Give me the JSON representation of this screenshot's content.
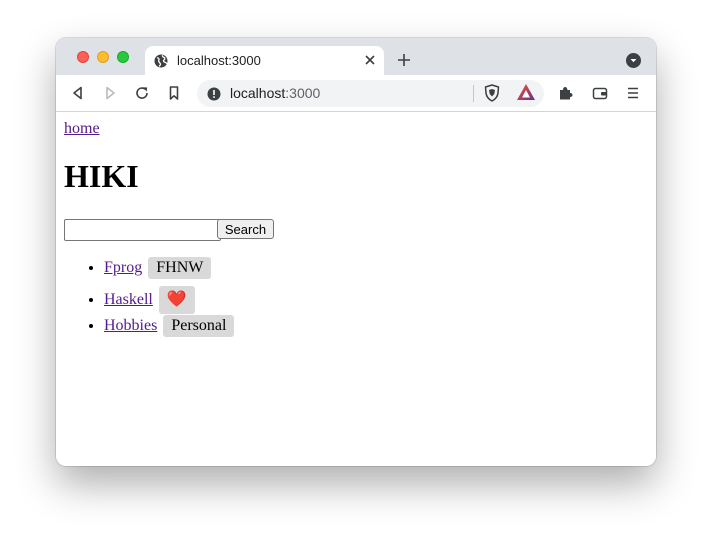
{
  "browser": {
    "tab_title": "localhost:3000",
    "url_host": "localhost",
    "url_port": ":3000",
    "icons": {
      "tab_favicon": "globe-icon",
      "tab_close": "close-icon",
      "new_tab": "plus-icon",
      "tab_search": "chevron-down-icon",
      "back": "back-icon",
      "forward": "forward-icon",
      "reload": "reload-icon",
      "bookmark": "bookmark-icon",
      "site_info": "info-icon",
      "shields": "brave-shields-icon",
      "rewards": "brave-rewards-icon",
      "extensions": "puzzle-icon",
      "wallet": "wallet-icon",
      "menu": "menu-icon"
    },
    "colors": {
      "close": "#fe5f57",
      "minimize": "#febc2e",
      "maximize": "#28c840",
      "brave_orange": "#fb542b",
      "rewards_purple": "#662d91"
    }
  },
  "page": {
    "home_link": "home",
    "title": "HIKI",
    "search": {
      "value": "",
      "button_label": "Search"
    },
    "items": [
      {
        "link": "Fprog",
        "tag": "FHNW"
      },
      {
        "link": "Haskell",
        "tag": "❤️"
      },
      {
        "link": "Hobbies",
        "tag": "Personal"
      }
    ],
    "colors": {
      "visited_link": "#551a8b",
      "tag_bg": "#d9d9d9"
    }
  }
}
